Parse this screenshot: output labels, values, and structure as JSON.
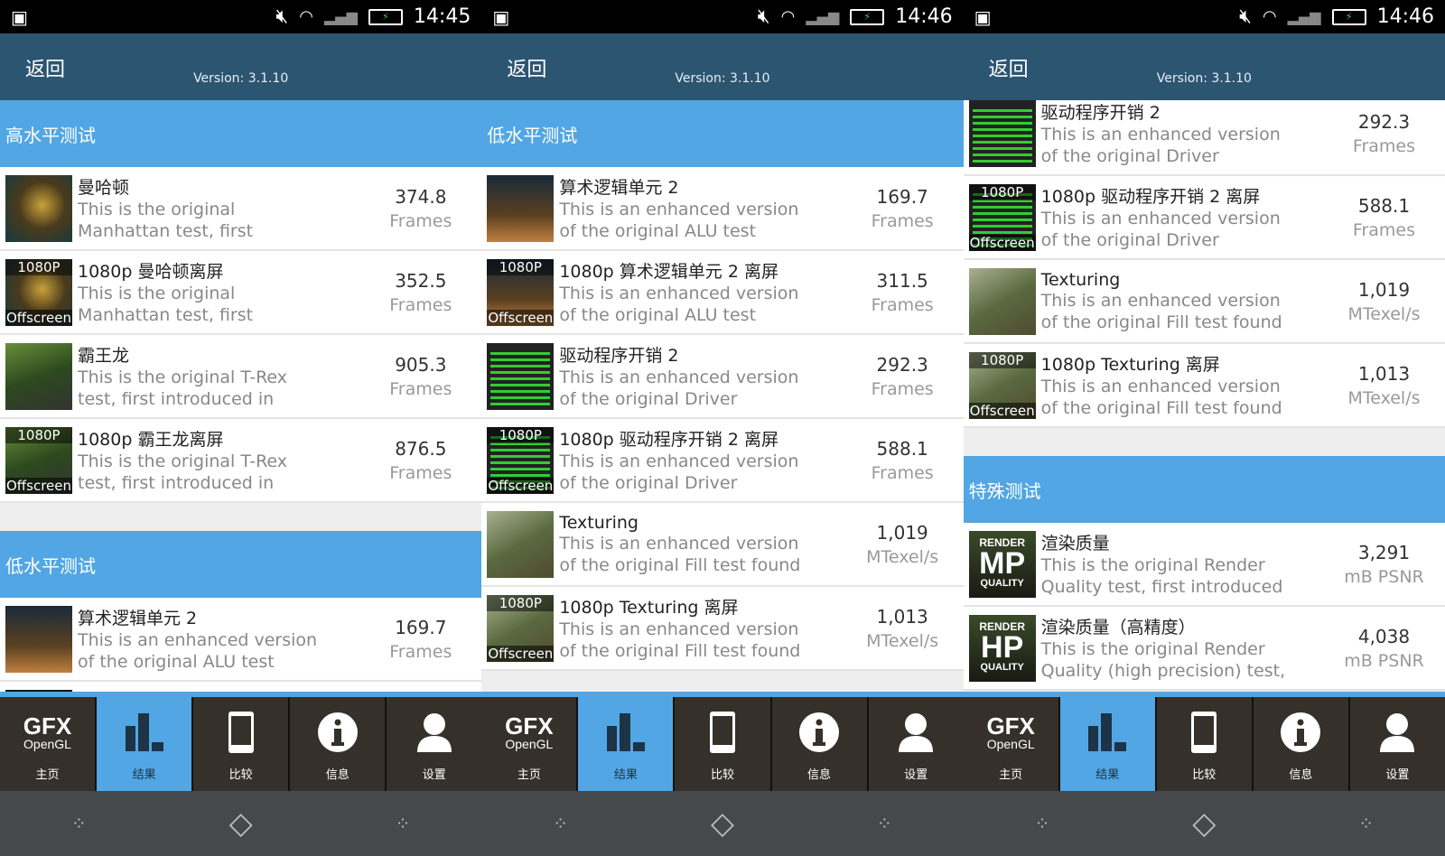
{
  "colors": {
    "header": "#2c5572",
    "section": "#51a6e3",
    "nav": "#35302a",
    "active_tab": "#51a6e3"
  },
  "panels": [
    {
      "time": "14:45",
      "back": "返回",
      "version": "Version: 3.1.10",
      "offset": 0,
      "items": [
        {
          "type": "section",
          "label": "高水平测试"
        },
        {
          "type": "row",
          "thumb": "manhattan",
          "name": "曼哈顿",
          "desc": [
            "This is the original",
            "Manhattan test, first"
          ],
          "value": "374.8",
          "unit": "Frames"
        },
        {
          "type": "row",
          "thumb": "manhattan",
          "offscreen": true,
          "name": "1080p 曼哈顿离屏",
          "desc": [
            "This is the original",
            "Manhattan test, first"
          ],
          "value": "352.5",
          "unit": "Frames"
        },
        {
          "type": "row",
          "thumb": "trex",
          "name": "霸王龙",
          "desc": [
            "This is the original T-Rex",
            "test, first introduced in"
          ],
          "value": "905.3",
          "unit": "Frames"
        },
        {
          "type": "row",
          "thumb": "trex",
          "offscreen": true,
          "name": "1080p 霸王龙离屏",
          "desc": [
            "This is the original T-Rex",
            "test, first introduced in"
          ],
          "value": "876.5",
          "unit": "Frames"
        },
        {
          "type": "gap"
        },
        {
          "type": "section",
          "label": "低水平测试"
        },
        {
          "type": "row",
          "thumb": "alu",
          "name": "算术逻辑单元 2",
          "desc": [
            "This is an enhanced version",
            "of the original ALU test"
          ],
          "value": "169.7",
          "unit": "Frames"
        },
        {
          "type": "row",
          "thumb": "alu",
          "offscreen": true,
          "name": "",
          "desc": [
            "",
            ""
          ],
          "value": "",
          "unit": ""
        }
      ]
    },
    {
      "time": "14:46",
      "back": "返回",
      "version": "Version: 3.1.10",
      "offset": 0,
      "items": [
        {
          "type": "section",
          "label": "低水平测试"
        },
        {
          "type": "row",
          "thumb": "alu",
          "name": "算术逻辑单元 2",
          "desc": [
            "This is an enhanced version",
            "of the original ALU test"
          ],
          "value": "169.7",
          "unit": "Frames"
        },
        {
          "type": "row",
          "thumb": "alu",
          "offscreen": true,
          "name": "1080p 算术逻辑单元 2 离屏",
          "desc": [
            "This is an enhanced version",
            "of the original ALU test"
          ],
          "value": "311.5",
          "unit": "Frames"
        },
        {
          "type": "row",
          "thumb": "driver",
          "name": "驱动程序开销 2",
          "desc": [
            "This is an enhanced version",
            "of the original Driver"
          ],
          "value": "292.3",
          "unit": "Frames"
        },
        {
          "type": "row",
          "thumb": "driver",
          "offscreen": true,
          "name": "1080p 驱动程序开销 2 离屏",
          "desc": [
            "This is an enhanced version",
            "of the original Driver"
          ],
          "value": "588.1",
          "unit": "Frames"
        },
        {
          "type": "row",
          "thumb": "tex",
          "name": "Texturing",
          "desc": [
            "This is an enhanced version",
            "of the original Fill test found"
          ],
          "value": "1,019",
          "unit": "MTexel/s"
        },
        {
          "type": "row",
          "thumb": "tex",
          "offscreen": true,
          "name": "1080p Texturing 离屏",
          "desc": [
            "This is an enhanced version",
            "of the original Fill test found"
          ],
          "value": "1,013",
          "unit": "MTexel/s"
        },
        {
          "type": "gap"
        }
      ]
    },
    {
      "time": "14:46",
      "back": "返回",
      "version": "Version: 3.1.10",
      "offset": -9,
      "items": [
        {
          "type": "row",
          "thumb": "driver",
          "name": "驱动程序开销 2",
          "desc": [
            "This is an enhanced version",
            "of the original Driver"
          ],
          "value": "292.3",
          "unit": "Frames"
        },
        {
          "type": "row",
          "thumb": "driver",
          "offscreen": true,
          "name": "1080p 驱动程序开销 2 离屏",
          "desc": [
            "This is an enhanced version",
            "of the original Driver"
          ],
          "value": "588.1",
          "unit": "Frames"
        },
        {
          "type": "row",
          "thumb": "tex",
          "name": "Texturing",
          "desc": [
            "This is an enhanced version",
            "of the original Fill test found"
          ],
          "value": "1,019",
          "unit": "MTexel/s"
        },
        {
          "type": "row",
          "thumb": "tex",
          "offscreen": true,
          "name": "1080p Texturing 离屏",
          "desc": [
            "This is an enhanced version",
            "of the original Fill test found"
          ],
          "value": "1,013",
          "unit": "MTexel/s"
        },
        {
          "type": "gap"
        },
        {
          "type": "section",
          "label": "特殊测试"
        },
        {
          "type": "row",
          "thumb": "render",
          "render": [
            "RENDER",
            "MP",
            "QUALITY"
          ],
          "name": "渲染质量",
          "desc": [
            "This is the original Render",
            "Quality test, first introduced"
          ],
          "value": "3,291",
          "unit": "mB PSNR"
        },
        {
          "type": "row",
          "thumb": "render",
          "render": [
            "RENDER",
            "HP",
            "QUALITY"
          ],
          "name": "渲染质量（高精度）",
          "desc": [
            "This is the original Render",
            "Quality (high precision) test,"
          ],
          "value": "4,038",
          "unit": "mB PSNR"
        }
      ]
    }
  ],
  "labels": {
    "tag_1080": "1080P",
    "tag_offscreen": "Offscreen"
  },
  "nav": {
    "logo_top": "GFX",
    "logo_bottom": "OpenGL",
    "tabs": [
      {
        "label": "主页",
        "icon": "gfx-logo"
      },
      {
        "label": "结果",
        "icon": "bar-chart-icon",
        "active": true
      },
      {
        "label": "比较",
        "icon": "phone-icon"
      },
      {
        "label": "信息",
        "icon": "info-icon"
      },
      {
        "label": "设置",
        "icon": "user-icon"
      }
    ]
  }
}
